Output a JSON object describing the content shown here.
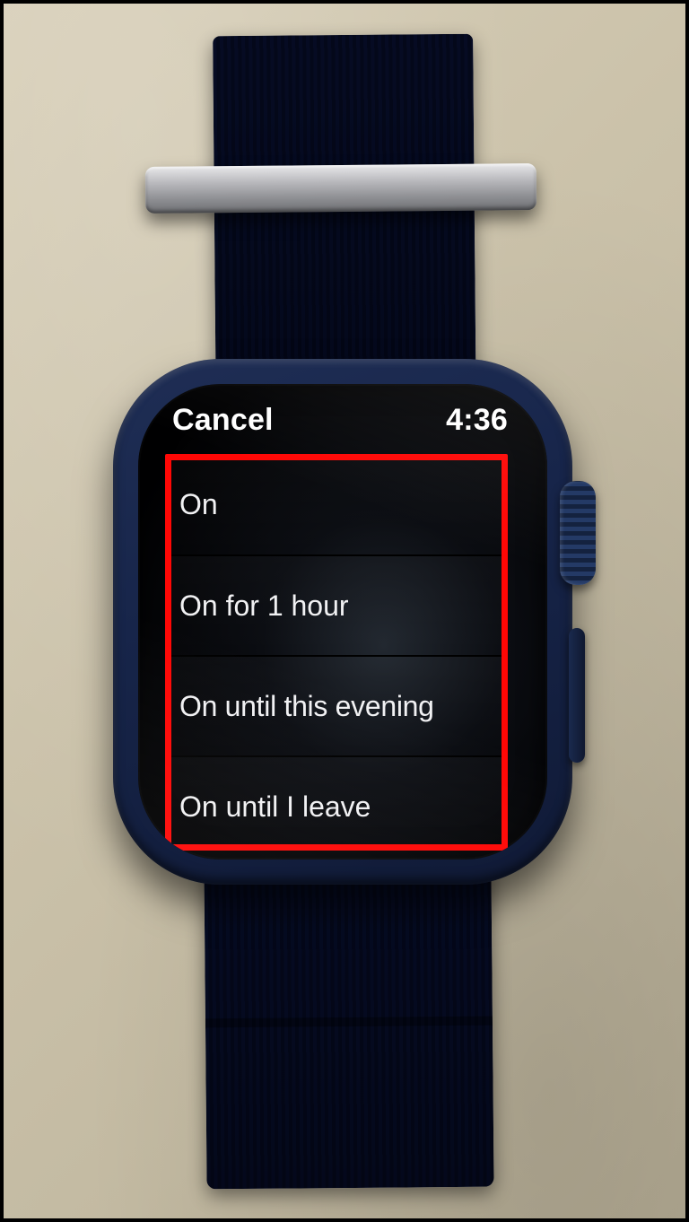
{
  "status": {
    "cancel_label": "Cancel",
    "time": "4:36"
  },
  "options": {
    "items": [
      {
        "label": "On"
      },
      {
        "label": "On for 1 hour"
      },
      {
        "label": "On until this evening"
      },
      {
        "label": "On until I leave"
      }
    ]
  },
  "annotation": {
    "highlight_color": "#ff0705"
  }
}
